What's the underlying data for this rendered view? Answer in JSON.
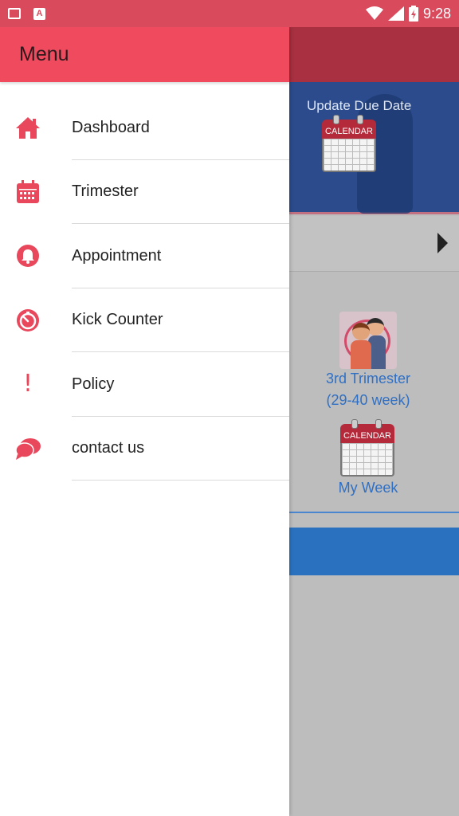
{
  "status_bar": {
    "time": "9:28",
    "left_icons": [
      "image-icon",
      "a-icon"
    ],
    "right_icons": [
      "wifi-icon",
      "signal-icon",
      "battery-icon"
    ]
  },
  "drawer": {
    "title": "Menu",
    "items": [
      {
        "label": "Dashboard",
        "icon": "home-icon"
      },
      {
        "label": "Trimester",
        "icon": "calendar-icon"
      },
      {
        "label": "Appointment",
        "icon": "bell-icon"
      },
      {
        "label": "Kick Counter",
        "icon": "timer-icon"
      },
      {
        "label": "Policy",
        "icon": "exclamation-icon"
      },
      {
        "label": "contact us",
        "icon": "chat-icon"
      }
    ]
  },
  "background": {
    "update_due_date_label": "Update Due Date",
    "calendar_label": "CALENDAR",
    "trimester_line1": "3rd Trimester",
    "trimester_line2": "(29-40 week)",
    "my_week_label": "My Week"
  },
  "colors": {
    "accent": "#ef4a5e",
    "status_bar": "#d94a5c",
    "link_blue": "#2f6fc4",
    "banner_blue": "#2b4b8c"
  }
}
